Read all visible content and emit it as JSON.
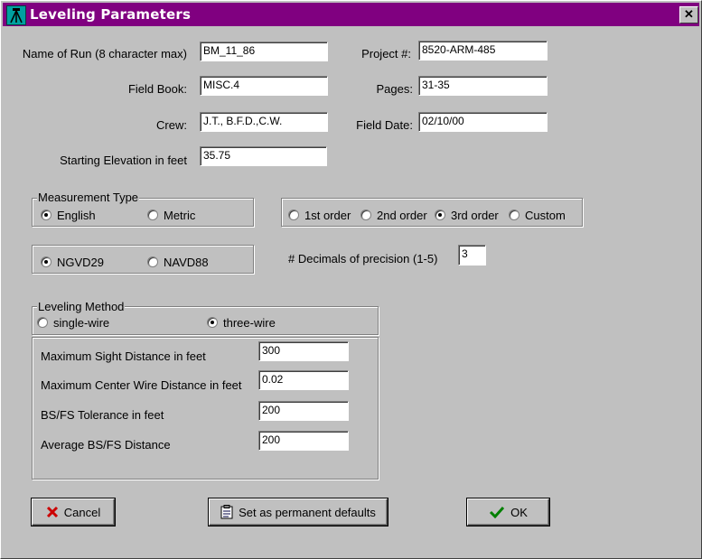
{
  "window": {
    "title": "Leveling Parameters",
    "close_label": "✕"
  },
  "run": {
    "name_label": "Name of Run (8 character max)",
    "name_value": "BM_11_86",
    "project_label": "Project #:",
    "project_value": "8520-ARM-485",
    "fieldbook_label": "Field Book:",
    "fieldbook_value": "MISC.4",
    "pages_label": "Pages:",
    "pages_value": "31-35",
    "crew_label": "Crew:",
    "crew_value": "J.T., B.F.D.,C.W.",
    "fielddate_label": "Field Date:",
    "fielddate_value": "02/10/00",
    "elevation_label": "Starting Elevation in feet",
    "elevation_value": "35.75"
  },
  "measurement": {
    "title": "Measurement Type",
    "options": [
      {
        "label": "English",
        "selected": true
      },
      {
        "label": "Metric",
        "selected": false
      }
    ]
  },
  "order": {
    "options": [
      {
        "label": "1st order",
        "selected": false
      },
      {
        "label": "2nd order",
        "selected": false
      },
      {
        "label": "3rd order",
        "selected": true
      },
      {
        "label": "Custom",
        "selected": false
      }
    ]
  },
  "datum": {
    "options": [
      {
        "label": "NGVD29",
        "selected": true
      },
      {
        "label": "NAVD88",
        "selected": false
      }
    ]
  },
  "precision": {
    "label": "# Decimals of precision (1-5)",
    "value": "3"
  },
  "leveling": {
    "title": "Leveling Method",
    "options": [
      {
        "label": "single-wire",
        "selected": false
      },
      {
        "label": "three-wire",
        "selected": true
      }
    ],
    "params": [
      {
        "label": "Maximum Sight Distance in feet",
        "value": "300"
      },
      {
        "label": "Maximum Center Wire Distance in feet",
        "value": "0.02"
      },
      {
        "label": "BS/FS Tolerance in feet",
        "value": "200"
      },
      {
        "label": "Average BS/FS Distance",
        "value": "200"
      }
    ]
  },
  "buttons": {
    "cancel": "Cancel",
    "defaults": "Set as permanent defaults",
    "ok": "OK"
  },
  "colors": {
    "titlebar": "#800080",
    "face": "#c0c0c0",
    "cancel_icon": "#cc0000",
    "ok_icon": "#008000"
  }
}
